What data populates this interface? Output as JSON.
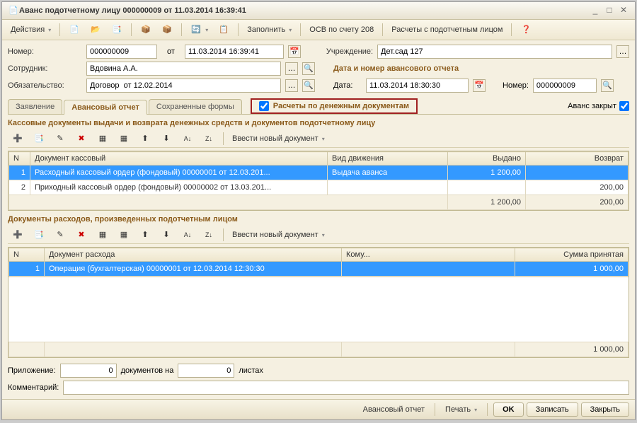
{
  "title": "Аванс подотчетному лицу 000000009 от 11.03.2014 16:39:41",
  "toolbar": {
    "actions": "Действия",
    "fill": "Заполнить",
    "osb": "ОСВ по счету 208",
    "settle": "Расчеты с подотчетным лицом"
  },
  "header": {
    "number_label": "Номер:",
    "number": "000000009",
    "from_label": "от",
    "date": "11.03.2014 16:39:41",
    "org_label": "Учреждение:",
    "org": "Дет.сад 127",
    "emp_label": "Сотрудник:",
    "emp": "Вдовина А.А.",
    "obl_label": "Обязательство:",
    "obl": "Договор  от 12.02.2014",
    "report_title": "Дата и номер авансового отчета",
    "rdate_label": "Дата:",
    "rdate": "11.03.2014 18:30:30",
    "rnum_label": "Номер:",
    "rnum": "000000009"
  },
  "tabs": {
    "t1": "Заявление",
    "t2": "Авансовый отчет",
    "t3": "Сохраненные формы"
  },
  "check_cash": "Расчеты по денежным документам",
  "closed_label": "Аванс закрыт",
  "section1": {
    "title": "Кассовые документы выдачи и возврата денежных средств и документов подотчетному лицу",
    "newdoc": "Ввести новый документ",
    "cols": {
      "n": "N",
      "doc": "Документ кассовый",
      "move": "Вид движения",
      "out": "Выдано",
      "ret": "Возврат"
    },
    "rows": [
      {
        "n": "1",
        "doc": "Расходный кассовый ордер (фондовый) 00000001 от 12.03.201...",
        "move": "Выдача аванса",
        "out": "1 200,00",
        "ret": ""
      },
      {
        "n": "2",
        "doc": "Приходный кассовый ордер (фондовый) 00000002 от 13.03.201...",
        "move": "",
        "out": "",
        "ret": "200,00"
      }
    ],
    "totals": {
      "out": "1 200,00",
      "ret": "200,00"
    }
  },
  "section2": {
    "title": "Документы расходов, произведенных подотчетным лицом",
    "newdoc": "Ввести новый документ",
    "cols": {
      "n": "N",
      "doc": "Документ расхода",
      "who": "Кому...",
      "sum": "Сумма принятая"
    },
    "rows": [
      {
        "n": "1",
        "doc": "Операция (бухгалтерская) 00000001 от 12.03.2014 12:30:30",
        "who": "",
        "sum": "1 000,00"
      }
    ],
    "total_sum": "1 000,00"
  },
  "attach": {
    "label": "Приложение:",
    "v1": "0",
    "docs": "документов на",
    "v2": "0",
    "sheets": "листах"
  },
  "comment_label": "Комментарий:",
  "footer": {
    "report": "Авансовый отчет",
    "print": "Печать",
    "ok": "OK",
    "save": "Записать",
    "close": "Закрыть"
  }
}
